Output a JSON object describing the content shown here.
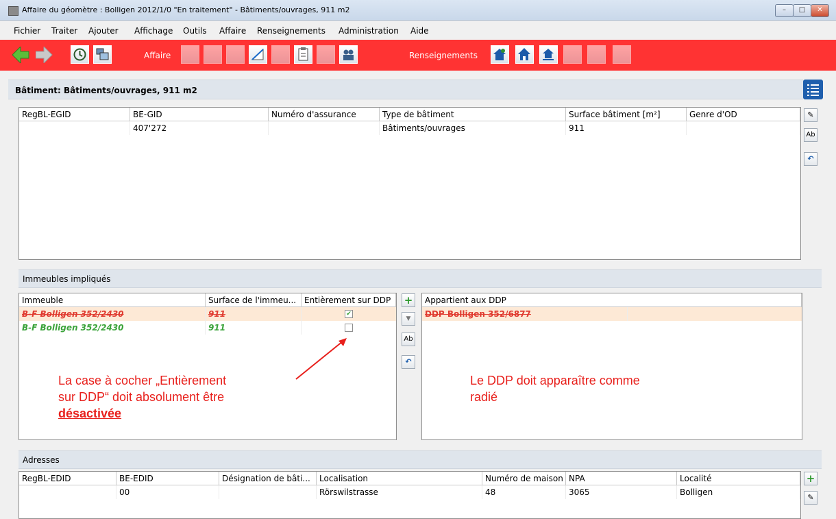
{
  "window": {
    "title": "Affaire du géomètre : Bolligen 2012/1/0 \"En traitement\"  - Bâtiments/ouvrages, 911 m2"
  },
  "menu": [
    "Fichier",
    "Traiter",
    "Ajouter",
    "Affichage",
    "Outils",
    "Affaire",
    "Renseignements",
    "Administration",
    "Aide"
  ],
  "toolbar": {
    "affaire_label": "Affaire",
    "renseignements_label": "Renseignements",
    "accent": "#ff3333"
  },
  "batiment": {
    "title": "Bâtiment: Bâtiments/ouvrages, 911 m2",
    "columns": [
      "RegBL-EGID",
      "BE-GID",
      "Numéro d'assurance",
      "Type de bâtiment",
      "Surface bâtiment [m²]",
      "Genre d'OD"
    ],
    "rows": [
      [
        "",
        "407'272",
        "",
        "Bâtiments/ouvrages",
        "911",
        ""
      ]
    ]
  },
  "immeubles": {
    "title": "Immeubles impliqués",
    "columns": [
      "Immeuble",
      "Surface de l'immeu...",
      "Entièrement sur DDP"
    ],
    "rows": [
      {
        "name": "B-F Bolligen 352/2430",
        "surface": "911",
        "checked": true,
        "state": "deleted"
      },
      {
        "name": "B-F Bolligen 352/2430",
        "surface": "911",
        "checked": false,
        "state": "new"
      }
    ],
    "ddp_header": "Appartient aux DDP",
    "ddp_rows": [
      "DDP Bolligen 352/6877"
    ]
  },
  "annotations": {
    "left_line1": "La case à cocher „Entièrement",
    "left_line2": "sur DDP“ doit absolument être",
    "left_line3": "désactivée",
    "right_line1": "Le DDP doit apparaître comme",
    "right_line2": "radié"
  },
  "adresses": {
    "title": "Adresses",
    "columns": [
      "RegBL-EDID",
      "BE-EDID",
      "Désignation de bâti...",
      "Localisation",
      "Numéro de maison",
      "NPA",
      "Localité"
    ],
    "rows": [
      [
        "",
        "00",
        "",
        "Rörswilstrasse",
        "48",
        "3065",
        "Bolligen"
      ]
    ]
  }
}
